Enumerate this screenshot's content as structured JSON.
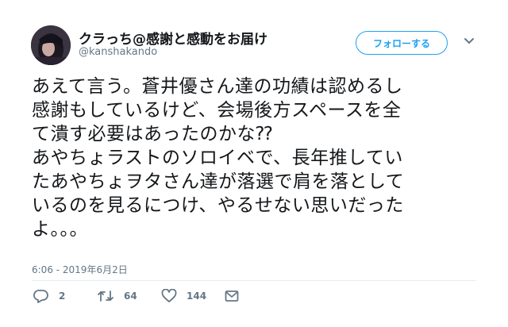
{
  "user": {
    "display_name": "クラっち@感謝と感動をお届け",
    "handle": "@kanshakando"
  },
  "follow_button_label": "フォローする",
  "tweet": {
    "lines": [
      "あえて言う。蒼井優さん達の功績は認めるし",
      "感謝もしているけど、会場後方スペースを全",
      "て潰す必要はあったのかな⁇",
      "あやちょラストのソロイベで、長年推してい",
      "たあやちょヲタさん達が落選で肩を落として",
      "いるのを見るにつけ、やるせない思いだった",
      "よ。。。"
    ],
    "timestamp": "6:06 - 2019年6月2日"
  },
  "actions": {
    "replies": "2",
    "retweets": "64",
    "likes": "144"
  },
  "colors": {
    "accent": "#1da1f2",
    "muted": "#657786",
    "text": "#14171a",
    "divider": "#e6ecf0"
  },
  "icons": [
    "avatar",
    "chevron-down-icon",
    "reply-icon",
    "retweet-icon",
    "like-icon",
    "message-icon"
  ]
}
